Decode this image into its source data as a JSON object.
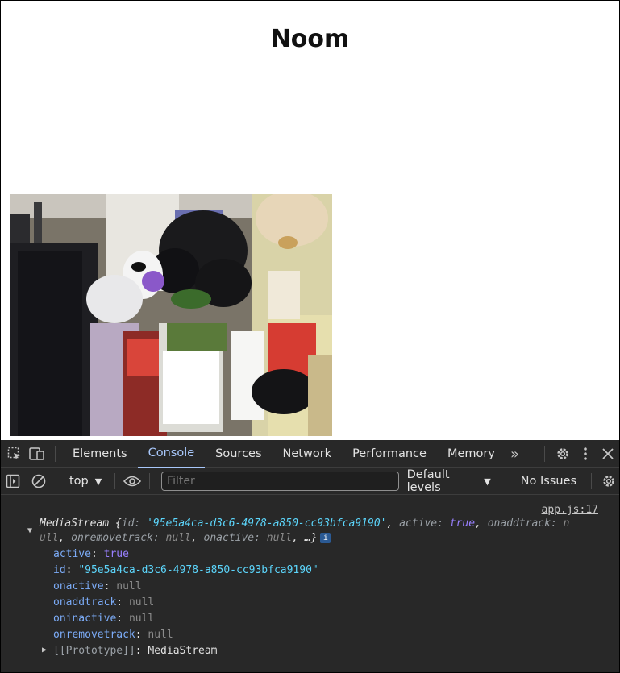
{
  "page": {
    "title": "Noom"
  },
  "devtools": {
    "tabs": [
      {
        "label": "Elements"
      },
      {
        "label": "Console"
      },
      {
        "label": "Sources"
      },
      {
        "label": "Network"
      },
      {
        "label": "Performance"
      },
      {
        "label": "Memory"
      }
    ],
    "more_tabs": "»",
    "toolbar": {
      "context": "top",
      "filter_placeholder": "Filter",
      "levels": "Default levels",
      "issues": "No Issues"
    },
    "console": {
      "source": "app.js:17",
      "summary": {
        "type": "MediaStream",
        "open": " {",
        "id_key": "id",
        "id_value": "'95e5a4ca-d3c6-4978-a850-cc93bfca9190'",
        "active_key": "active",
        "active_value": "true",
        "onaddtrack_key": "onaddtrack",
        "line2_prefix": "null",
        "onremovetrack_key": "onremovetrack",
        "onremovetrack_value": "null",
        "onactive_key": "onactive",
        "onactive_value": "null",
        "ellipsis": "…}",
        "sep": ": ",
        "comma": ", ",
        "badge": "i"
      },
      "props": [
        {
          "key": "active",
          "value": "true",
          "kind": "bool"
        },
        {
          "key": "id",
          "value": "\"95e5a4ca-d3c6-4978-a850-cc93bfca9190\"",
          "kind": "str"
        },
        {
          "key": "onactive",
          "value": "null",
          "kind": "null"
        },
        {
          "key": "onaddtrack",
          "value": "null",
          "kind": "null"
        },
        {
          "key": "oninactive",
          "value": "null",
          "kind": "null"
        },
        {
          "key": "onremovetrack",
          "value": "null",
          "kind": "null"
        }
      ],
      "prototype_key": "[[Prototype]]",
      "prototype_value": "MediaStream"
    }
  },
  "colors": {
    "devtools_bg": "#282828",
    "accent": "#a8c7fa",
    "string": "#5cd5fb",
    "boolean": "#9980ff",
    "key": "#7cacf8"
  }
}
